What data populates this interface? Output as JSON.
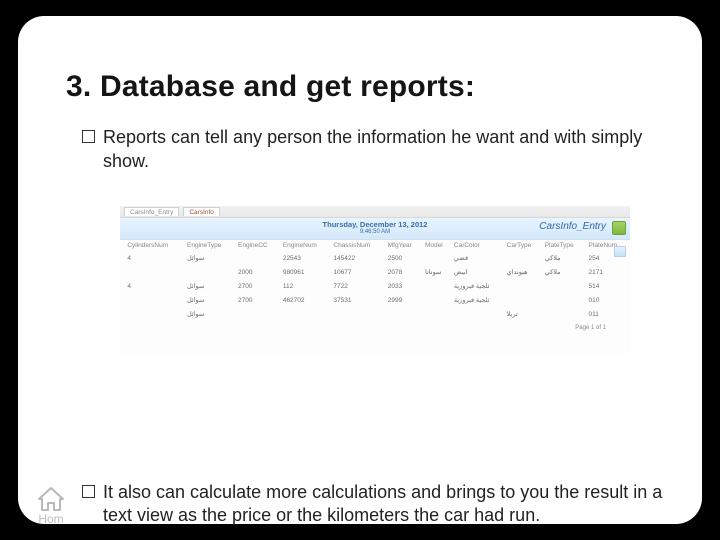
{
  "title": "3.  Database and get reports:",
  "bullets": {
    "b1": "Reports can tell any person the information he want and with simply show.",
    "b2": "It also can calculate more calculations and brings to you the result in a text view as the price or the kilometers the car had run."
  },
  "home_label": "Hom",
  "report": {
    "tab1": "CarsInfo_Entry",
    "tab2": "CarsInfo",
    "header_date": "Thursday, December 13, 2012",
    "header_time": "9:46:50 AM",
    "brand": "CarsInfo_Entry",
    "columns": [
      "",
      "CylindersNum",
      "EngineType",
      "EngineCC",
      "EngineNum",
      "ChassisNum",
      "MfgYear",
      "Model",
      "CarColor",
      "CarType",
      "PlateType",
      "PlateNum"
    ],
    "rows": [
      [
        "",
        "4",
        "سوائل",
        "",
        "22543",
        "145422",
        "2500",
        "",
        "فضي",
        "",
        "ملاكي",
        "254"
      ],
      [
        "",
        "",
        "",
        "2000",
        "980961",
        "10677",
        "2078",
        "سوناتا",
        "ابيض",
        "هيونداي",
        "ملاكي",
        "2171"
      ],
      [
        "",
        "4",
        "سوائل",
        "2700",
        "112",
        "7722",
        "2033",
        "",
        "ثلجية فيروزية",
        "",
        "",
        "514"
      ],
      [
        "",
        "",
        "سوائل",
        "2700",
        "462702",
        "37531",
        "2999",
        "",
        "ثلجية فيروزية",
        "",
        "",
        "010"
      ],
      [
        "",
        "",
        "سوائل",
        "",
        "",
        "",
        "",
        "",
        "",
        "تريلا",
        "",
        "011"
      ]
    ],
    "footer": "Page 1 of 1"
  }
}
